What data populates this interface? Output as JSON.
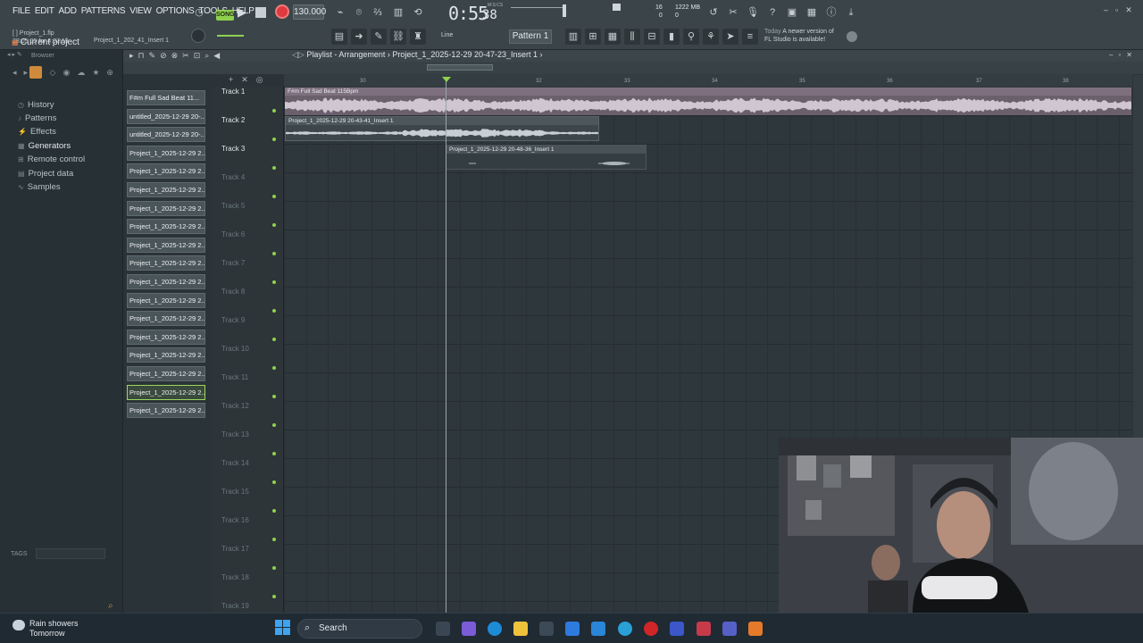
{
  "menu": [
    "FILE",
    "EDIT",
    "ADD",
    "PATTERNS",
    "VIEW",
    "OPTIONS",
    "TOOLS",
    "HELP"
  ],
  "transport": {
    "song_label": "SONG",
    "tempo": "130.000",
    "time_main": "0:55",
    "time_ms": "38",
    "time_unit": "M:S:CS"
  },
  "performance": {
    "cpu": "16",
    "cpu_sub": "0",
    "memory": "1222 MB",
    "memory_sub": "0"
  },
  "project": {
    "file": "[ ] Project_1.flp",
    "time_info": "28:05:05 for 4:07:19",
    "hint": "Project_1_202_41_Insert 1"
  },
  "snap": "Line",
  "pattern_selector": "Pattern 1",
  "news": {
    "when": "Today",
    "text_1": "A newer version of",
    "text_2": "FL Studio is available!"
  },
  "browser": {
    "title": "Browser",
    "root": "Current project",
    "items": [
      {
        "label": "History",
        "icon": "history-icon"
      },
      {
        "label": "Patterns",
        "icon": "note-icon"
      },
      {
        "label": "Effects",
        "icon": "plug-icon"
      },
      {
        "label": "Generators",
        "icon": "generator-icon"
      },
      {
        "label": "Remote control",
        "icon": "remote-icon"
      },
      {
        "label": "Project data",
        "icon": "file-icon"
      },
      {
        "label": "Samples",
        "icon": "wave-icon"
      }
    ],
    "tags_label": "TAGS"
  },
  "playlist": {
    "title": "Playlist - Arrangement",
    "current_clip": "Project_1_2025-12-29 20-47-23_Insert 1"
  },
  "pattern_clips": [
    "F#m Full Sad Beat 11...",
    "untitled_2025-12-29 20-...",
    "untitled_2025-12-29 20-...",
    "Project_1_2025-12-29 2...",
    "Project_1_2025-12-29 2...",
    "Project_1_2025-12-29 2...",
    "Project_1_2025-12-29 2...",
    "Project_1_2025-12-29 2...",
    "Project_1_2025-12-29 2...",
    "Project_1_2025-12-29 2...",
    "Project_1_2025-12-29 2...",
    "Project_1_2025-12-29 2...",
    "Project_1_2025-12-29 2...",
    "Project_1_2025-12-29 2...",
    "Project_1_2025-12-29 2...",
    "Project_1_2025-12-29 2...",
    "Project_1_2025-12-29 2...",
    "Project_1_2025-12-29 2..."
  ],
  "tracks": [
    "Track 1",
    "Track 2",
    "Track 3",
    "Track 4",
    "Track 5",
    "Track 6",
    "Track 7",
    "Track 8",
    "Track 9",
    "Track 10",
    "Track 11",
    "Track 12",
    "Track 13",
    "Track 14",
    "Track 15",
    "Track 16",
    "Track 17",
    "Track 18",
    "Track 19"
  ],
  "ruler_bars": [
    "30",
    "32",
    "33",
    "34",
    "35",
    "36",
    "37",
    "38"
  ],
  "audio_clips": [
    {
      "label": "F#m Full Sad Beat 115Bpm",
      "track": 1
    },
    {
      "label": "Project_1_2025-12-29 20-43-41_Insert 1",
      "track": 2
    },
    {
      "label": "Project_1_2025-12-29 20-48-36_Insert 1",
      "track": 3
    }
  ],
  "taskbar": {
    "weather_title": "Rain showers",
    "weather_sub": "Tomorrow",
    "search": "Search"
  }
}
